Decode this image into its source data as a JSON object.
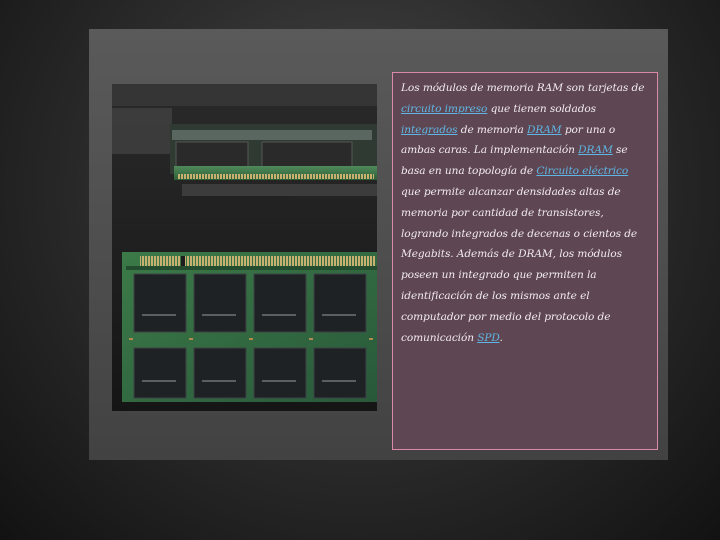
{
  "slide": {
    "image": {
      "alt": "",
      "chip_labels": [
        "",
        "",
        "",
        "",
        "",
        "",
        "",
        ""
      ]
    },
    "text": {
      "s1": "Los módulos de memoria RAM son tarjetas de ",
      "link_circuito_impreso": "circuito impreso",
      "s2": " que tienen soldados ",
      "link_integrados": "integrados",
      "s3": " de memoria ",
      "link_dram_1": "DRAM",
      "s4": " por una o ambas caras. La implementación ",
      "link_dram_2": "DRAM",
      "s5": " se basa en una topología de ",
      "link_circuito_electrico": "Circuito eléctrico",
      "s6": " que permite alcanzar densidades altas de memoria por cantidad de transistores, logrando integrados de decenas o cientos de Megabits. Además de DRAM, los módulos poseen un integrado que permiten la identificación de los mismos ante el computador por medio del protocolo de comunicación ",
      "link_spd": "SPD",
      "s7": "."
    }
  },
  "colors": {
    "text_box_bg": "#5e4752",
    "text_box_border": "#d88aa6",
    "link": "#5fb6e6",
    "pcb_green": "#2f6b3a"
  }
}
